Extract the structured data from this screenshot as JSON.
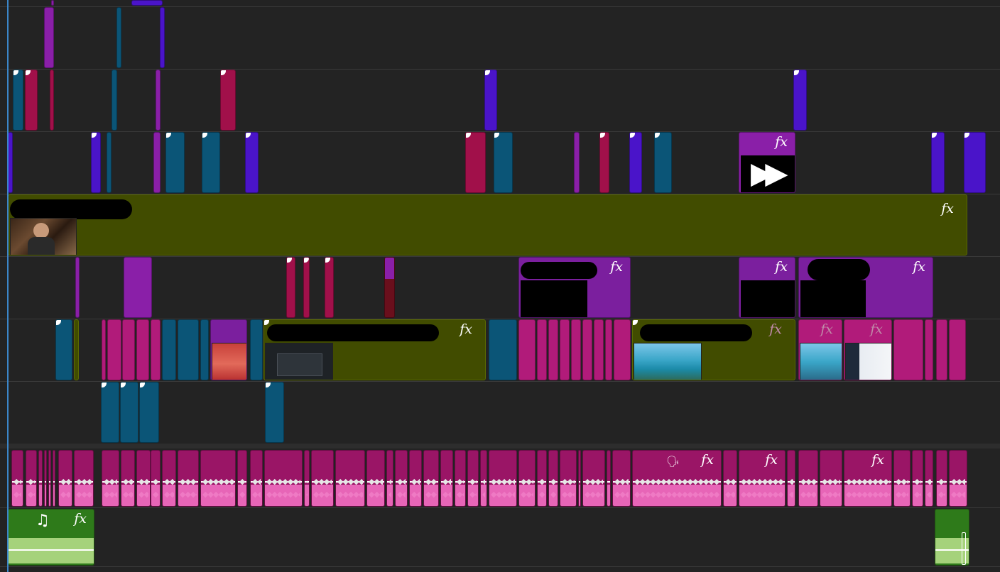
{
  "timeline": {
    "fx_label": "fx",
    "icons": {
      "fast_forward": "fast-forward-icon",
      "music_note": "music-note-icon",
      "voice": "voice-enhance-icon",
      "fx": "fx-badge-icon",
      "playhead": "playhead-line"
    },
    "glyphs": {
      "fast_forward": "▶▶",
      "music_note": "♫",
      "voice": "🗣",
      "keyframes": "◆◆◆◆◆◆◆◆◆◆◆◆◆◆◆◆◆◆◆◆"
    },
    "colors": {
      "background": "#232323",
      "playhead": "#3b86c9",
      "purple": "#8a1fa8",
      "teal": "#0b5577",
      "crimson": "#a1104a",
      "indigo": "#4a14c9",
      "magenta": "#b11b7a",
      "olive": "#414c00",
      "audio_pink": "#9a1566",
      "audio_wave": "#f06ec0",
      "music_green": "#2e7a1a"
    }
  }
}
